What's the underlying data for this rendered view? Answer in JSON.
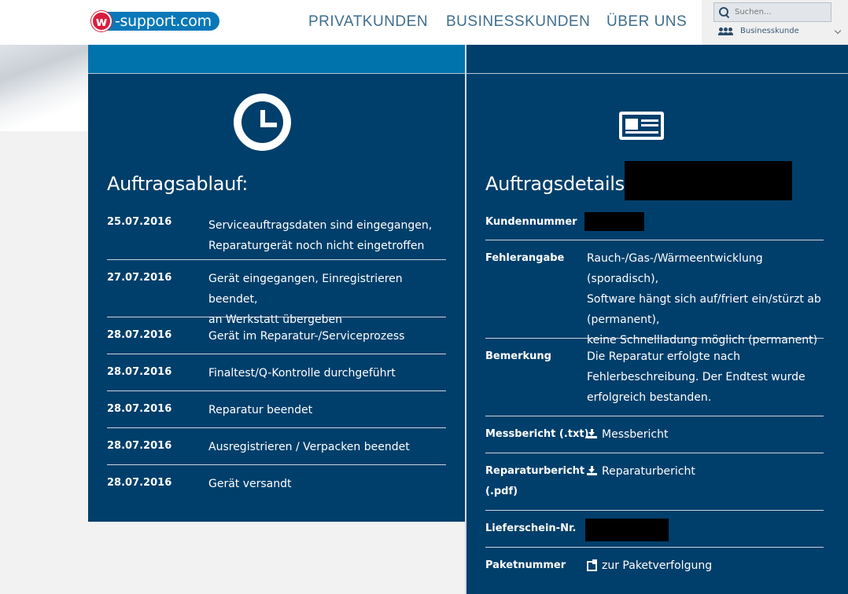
{
  "header": {
    "logo_letter": "w",
    "logo_text": "-support.com",
    "nav": [
      "PRIVATKUNDEN",
      "BUSINESSKUNDEN",
      "ÜBER UNS"
    ],
    "search_placeholder": "Suchen...",
    "customer_type": "Businesskunde"
  },
  "left": {
    "heading": "Auftragsablauf:",
    "timeline": [
      {
        "date": "25.07.2016",
        "lines": [
          "Serviceauftragsdaten sind eingegangen,",
          "Reparaturgerät noch nicht eingetroffen"
        ]
      },
      {
        "date": "27.07.2016",
        "lines": [
          "Gerät eingegangen, Einregistrieren beendet,",
          "an Werkstatt übergeben"
        ]
      },
      {
        "date": "28.07.2016",
        "lines": [
          "Gerät im Reparatur-/Serviceprozess"
        ]
      },
      {
        "date": "28.07.2016",
        "lines": [
          "Finaltest/Q-Kontrolle durchgeführt"
        ]
      },
      {
        "date": "28.07.2016",
        "lines": [
          "Reparatur beendet"
        ]
      },
      {
        "date": "28.07.2016",
        "lines": [
          "Ausregistrieren / Verpacken beendet"
        ]
      },
      {
        "date": "28.07.2016",
        "lines": [
          "Gerät versandt"
        ]
      }
    ]
  },
  "right": {
    "heading": "Auftragsdetails:",
    "kundennummer_label": "Kundennummer",
    "fehlerangabe_label": "Fehlerangabe",
    "fehlerangabe_lines": [
      "Rauch-/Gas-/Wärmeentwicklung (sporadisch),",
      "Software hängt sich auf/friert ein/stürzt ab",
      "(permanent),",
      "keine Schnellladung möglich (permanent)"
    ],
    "bemerkung_label": "Bemerkung",
    "bemerkung_lines": [
      "Die Reparatur erfolgte nach",
      "Fehlerbeschreibung. Der Endtest wurde",
      "erfolgreich bestanden."
    ],
    "messbericht_label": "Messbericht (.txt)",
    "messbericht_link": "Messbericht",
    "reparaturbericht_label_1": "Reparaturbericht",
    "reparaturbericht_label_2": "(.pdf)",
    "reparaturbericht_link": "Reparaturbericht",
    "lieferschein_label": "Lieferschein-Nr.",
    "paketnummer_label": "Paketnummer",
    "paket_link": "zur Paketverfolgung"
  }
}
